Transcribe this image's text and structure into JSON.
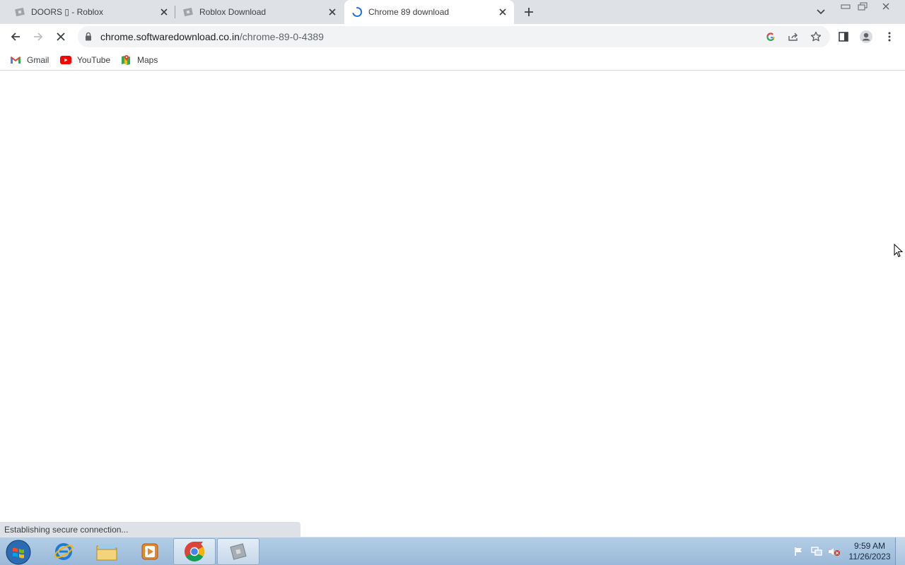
{
  "tabs": [
    {
      "title": "DOORS ▯ - Roblox",
      "favicon": "roblox-icon"
    },
    {
      "title": "Roblox Download",
      "favicon": "roblox-icon"
    },
    {
      "title": "Chrome 89 download",
      "favicon": "loading-spinner-icon",
      "active": true
    }
  ],
  "address_bar": {
    "host": "chrome.softwaredownload.co.in",
    "path": "/chrome-89-0-4389"
  },
  "bookmarks": [
    {
      "label": "Gmail",
      "icon": "gmail-icon"
    },
    {
      "label": "YouTube",
      "icon": "youtube-icon"
    },
    {
      "label": "Maps",
      "icon": "maps-icon"
    }
  ],
  "status_bar": "Establishing secure connection...",
  "clock": {
    "time": "9:59 AM",
    "date": "11/26/2023"
  },
  "colors": {
    "accent": "#1a73e8",
    "tabstrip": "#dee1e6",
    "taskbar": "#a9c3dd"
  }
}
